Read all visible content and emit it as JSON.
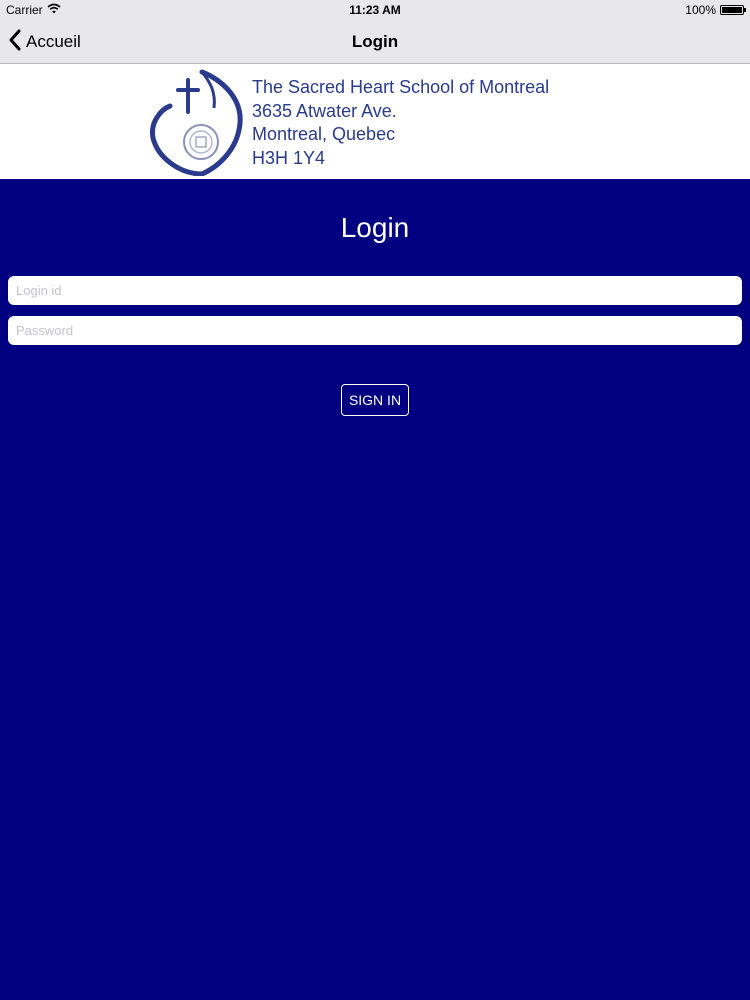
{
  "status_bar": {
    "carrier": "Carrier",
    "time": "11:23 AM",
    "battery": "100%"
  },
  "nav": {
    "back_label": "Accueil",
    "title": "Login"
  },
  "school": {
    "lines": [
      "The Sacred Heart School of Montreal",
      "3635 Atwater Ave.",
      "Montreal, Quebec",
      "H3H 1Y4"
    ]
  },
  "login": {
    "title": "Login",
    "login_placeholder": "Login id",
    "password_placeholder": "Password",
    "sign_in_label": "SIGN IN"
  },
  "colors": {
    "background": "#000080",
    "brand": "#2a3a8c",
    "nav_bar": "#e8e7ea"
  },
  "icons": {
    "wifi": "wifi-icon",
    "battery": "battery-icon",
    "back": "chevron-left-icon",
    "logo": "sacred-heart-logo"
  }
}
